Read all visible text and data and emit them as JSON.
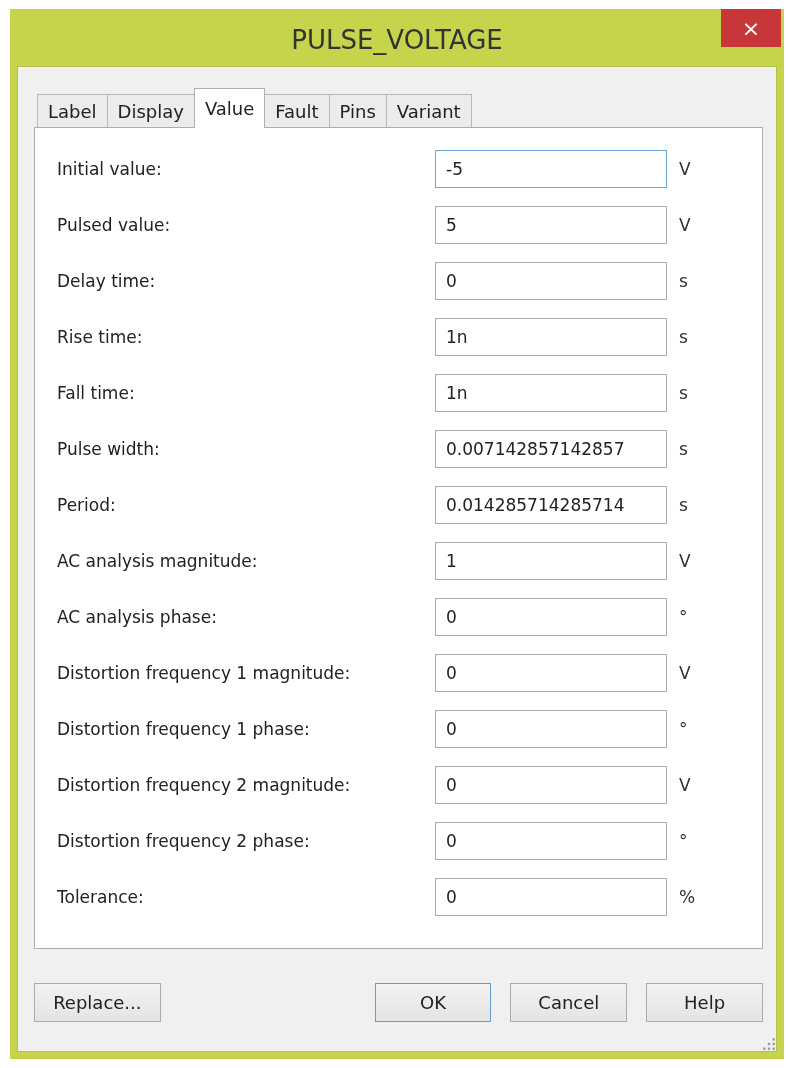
{
  "window": {
    "title": "PULSE_VOLTAGE",
    "close": "×"
  },
  "tabs": [
    {
      "label": "Label",
      "selected": false
    },
    {
      "label": "Display",
      "selected": false
    },
    {
      "label": "Value",
      "selected": true
    },
    {
      "label": "Fault",
      "selected": false
    },
    {
      "label": "Pins",
      "selected": false
    },
    {
      "label": "Variant",
      "selected": false
    }
  ],
  "fields": [
    {
      "label": "Initial value:",
      "value": "-5",
      "unit": "V",
      "focused": true
    },
    {
      "label": "Pulsed value:",
      "value": "5",
      "unit": "V",
      "focused": false
    },
    {
      "label": "Delay time:",
      "value": "0",
      "unit": "s",
      "focused": false
    },
    {
      "label": "Rise time:",
      "value": "1n",
      "unit": "s",
      "focused": false
    },
    {
      "label": "Fall time:",
      "value": "1n",
      "unit": "s",
      "focused": false
    },
    {
      "label": "Pulse width:",
      "value": "0.007142857142857",
      "unit": "s",
      "focused": false
    },
    {
      "label": "Period:",
      "value": "0.014285714285714",
      "unit": "s",
      "focused": false
    },
    {
      "label": "AC analysis magnitude:",
      "value": "1",
      "unit": "V",
      "focused": false
    },
    {
      "label": "AC analysis phase:",
      "value": "0",
      "unit": "°",
      "focused": false
    },
    {
      "label": "Distortion frequency 1 magnitude:",
      "value": "0",
      "unit": "V",
      "focused": false
    },
    {
      "label": "Distortion frequency 1 phase:",
      "value": "0",
      "unit": "°",
      "focused": false
    },
    {
      "label": "Distortion frequency 2 magnitude:",
      "value": "0",
      "unit": "V",
      "focused": false
    },
    {
      "label": "Distortion frequency 2 phase:",
      "value": "0",
      "unit": "°",
      "focused": false
    },
    {
      "label": "Tolerance:",
      "value": "0",
      "unit": "%",
      "focused": false
    }
  ],
  "buttons": [
    {
      "label": "Replace...",
      "default": false
    },
    {
      "label": "OK",
      "default": true
    },
    {
      "label": "Cancel",
      "default": false
    },
    {
      "label": "Help",
      "default": false
    }
  ]
}
